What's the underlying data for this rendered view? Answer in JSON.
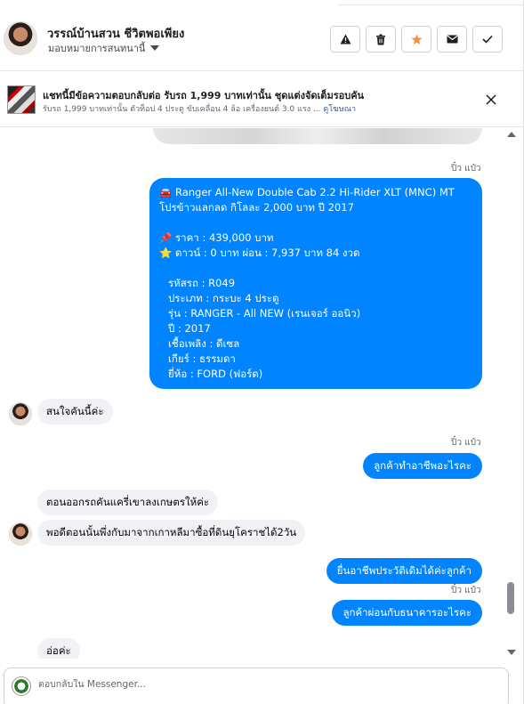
{
  "contact": {
    "name": "วรรณ์บ้านสวน ชีวิตพอเพียง",
    "assign_label": "มอบหมายการสนทนานี้"
  },
  "actions": [
    {
      "icon": "alert-icon",
      "name": "spam-button"
    },
    {
      "icon": "trash-icon",
      "name": "delete-button"
    },
    {
      "icon": "star-icon",
      "name": "star-button"
    },
    {
      "icon": "mail-icon",
      "name": "mark-unread-button"
    },
    {
      "icon": "check-icon",
      "name": "mark-done-button"
    }
  ],
  "ad": {
    "title": "แชทนี้มีข้อความตอบกลับต่อ รับรถ 1,999 บาทเท่านั้น ชุดแต่งจัดเต็มรอบคัน",
    "subtitle": "รับรถ 1,999 บาทเท่านั้น ตัวท็อป 4 ประตู ขับเคลื่อน 4 ล้อ เครื่องยนต์ 3.0 แรง ...",
    "link": "ดูโฆษณา"
  },
  "messages": {
    "sender_1": "ปิ๋ว แป๋ว",
    "car_lines": [
      "🚘 Ranger All-New Double Cab 2.2 Hi-Rider XLT (MNC) MT",
      "โปรข้าวแลกลด กิโลละ 2,000 บาท ปี 2017",
      "",
      "📌 ราคา : 439,000 บาท",
      "⭐ ดาวน์ : 0 บาท ผ่อน : 7,937 บาท 84 งวด",
      "",
      "รหัสรถ : R049",
      "ประเภท : กระบะ 4 ประตู",
      "รุ่น : RANGER - All NEW (เรนเจอร์ ออนิว)",
      "ปี : 2017",
      "เชื้อเพลิง : ดีเซล",
      "เกียร์ : ธรรมดา",
      "ยี่ห้อ : FORD (ฟอร์ด)"
    ],
    "in_1": "สนใจคันนี้ค่ะ",
    "sender_2": "ปิ๋ว แป๋ว",
    "out_1": "ลูกค้าทำอาชีพอะไรคะ",
    "in_2": "ตอนออกรถคันแครี่เขาลงเกษตรให้ค่ะ",
    "in_3": "พอดีตอนนั้นพึ่งกับมาจากเกาหลีมาซื้อที่ดินยุโคราชได้2วัน",
    "out_2": "ยื่นอาชีพประวัติเดิมได้ค่ะลูกค้า",
    "sender_3": "ปิ๋ว แป๋ว",
    "out_3": "ลูกค้าผ่อนกับธนาคารอะไรคะ",
    "in_4": "อ่อค่ะ"
  },
  "reply": {
    "placeholder": "ตอบกลับใน Messenger..."
  },
  "colors": {
    "outgoing": "#0084ff",
    "incoming": "#f0f2f5",
    "star": "#f7923a"
  }
}
